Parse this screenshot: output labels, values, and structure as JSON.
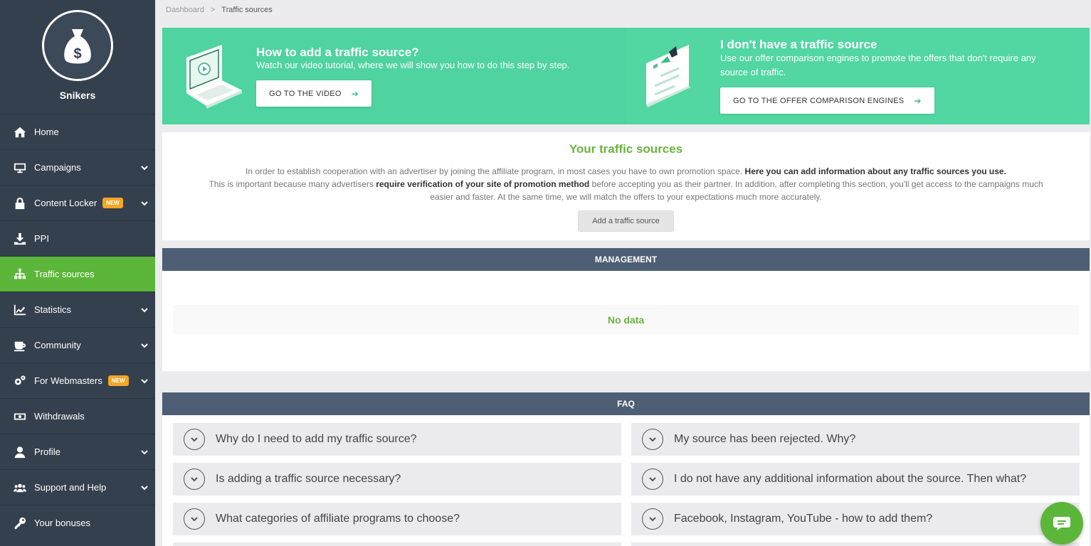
{
  "user": {
    "name": "Snikers"
  },
  "sidebar": {
    "items": [
      {
        "label": "Home",
        "icon": "home-icon"
      },
      {
        "label": "Campaigns",
        "icon": "monitor-icon"
      },
      {
        "label": "Content Locker",
        "icon": "lock-icon",
        "badge": "NEW"
      },
      {
        "label": "PPI",
        "icon": "download-icon"
      },
      {
        "label": "Traffic sources",
        "icon": "sitemap-icon"
      },
      {
        "label": "Statistics",
        "icon": "chart-icon"
      },
      {
        "label": "Community",
        "icon": "coffee-icon"
      },
      {
        "label": "For Webmasters",
        "icon": "gears-icon",
        "badge": "NEW"
      },
      {
        "label": "Withdrawals",
        "icon": "money-icon"
      },
      {
        "label": "Profile",
        "icon": "user-icon"
      },
      {
        "label": "Support and Help",
        "icon": "users-icon"
      },
      {
        "label": "Your bonuses",
        "icon": "key-icon"
      }
    ]
  },
  "breadcrumb": {
    "root": "Dashboard",
    "separator": ">",
    "current": "Traffic sources"
  },
  "banner": {
    "left": {
      "title": "How to add a traffic source?",
      "desc": "Watch our video tutorial, where we will show you how to do this step by step.",
      "button": "GO TO THE VIDEO"
    },
    "right": {
      "title": "I don't have a traffic source",
      "desc1": "Use our offer comparison engines to promote the offers that don't require any",
      "desc2": "source of traffic.",
      "button": "GO TO THE OFFER COMPARISON ENGINES"
    }
  },
  "traffic_sources": {
    "title": "Your traffic sources",
    "line1_a": "In order to establish cooperation with an advertiser by joining the affiliate program, in most cases you have to own promotion space. ",
    "line1_b": "Here you can add information about any traffic sources you use.",
    "line2_a": "This is important because many advertisers ",
    "line2_b": "require verification of your site of promotion method",
    "line2_c": " before accepting you as their partner. In addition, after completing this section, you'll get access to the campaigns much",
    "line3": "easier and faster. At the same time, we will match the offers to your expectations much more accurately.",
    "add_button": "Add a traffic source"
  },
  "management": {
    "header": "MANAGEMENT",
    "empty": "No data"
  },
  "faq": {
    "header": "FAQ",
    "items": [
      "Why do I need to add my traffic source?",
      "My source has been rejected. Why?",
      "Is adding a traffic source necessary?",
      "I do not have any additional information about the source. Then what?",
      "What categories of affiliate programs to choose?",
      "Facebook, Instagram, YouTube - how to add them?"
    ]
  },
  "colors": {
    "accent": "#5cb63a",
    "sidebar": "#34404e",
    "header": "#4d5e75",
    "banner": "#4fd3a0",
    "badge": "#f5a623"
  }
}
